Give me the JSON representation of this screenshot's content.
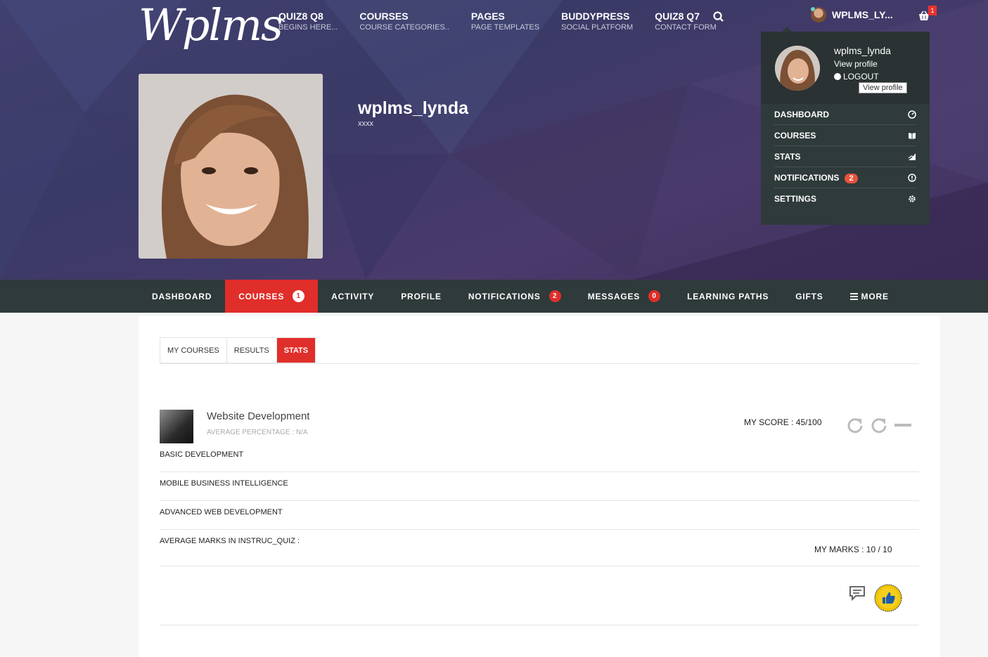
{
  "brand": {
    "logo_text": "Wplms"
  },
  "top_nav": [
    {
      "title": "QUIZ8 Q8",
      "sub": "BEGINS HERE..."
    },
    {
      "title": "COURSES",
      "sub": "COURSE CATEGORIES.."
    },
    {
      "title": "PAGES",
      "sub": "PAGE TEMPLATES"
    },
    {
      "title": "BUDDYPRESS",
      "sub": "SOCIAL PLATFORM"
    },
    {
      "title": "QUIZ8 Q7",
      "sub": "CONTACT FORM"
    }
  ],
  "header_user": {
    "name": "WPLMS_LY...",
    "cart_count": "1"
  },
  "profile": {
    "name": "wplms_lynda",
    "sub": "xxxx"
  },
  "dropdown": {
    "name": "wplms_lynda",
    "view_profile": "View profile",
    "logout": "LOGOUT",
    "tooltip": "View profile",
    "items": [
      {
        "label": "DASHBOARD",
        "icon": "dashboard-icon"
      },
      {
        "label": "COURSES",
        "icon": "book-icon"
      },
      {
        "label": "STATS",
        "icon": "stats-icon"
      },
      {
        "label": "NOTIFICATIONS",
        "badge": "2",
        "icon": "alert-icon"
      },
      {
        "label": "SETTINGS",
        "icon": "gear-icon"
      }
    ]
  },
  "tabs": [
    {
      "label": "DASHBOARD"
    },
    {
      "label": "COURSES",
      "count": "1"
    },
    {
      "label": "ACTIVITY"
    },
    {
      "label": "PROFILE"
    },
    {
      "label": "NOTIFICATIONS",
      "count": "2"
    },
    {
      "label": "MESSAGES",
      "count": "0"
    },
    {
      "label": "LEARNING PATHS"
    },
    {
      "label": "GIFTS"
    },
    {
      "label": "MORE"
    }
  ],
  "subtabs": [
    "MY COURSES",
    "RESULTS",
    "STATS"
  ],
  "course": {
    "title": "Website Development",
    "average": "AVERAGE PERCENTAGE : N/A",
    "score": "MY SCORE : 45/100",
    "units": [
      "BASIC DEVELOPMENT",
      "MOBILE BUSINESS INTELLIGENCE",
      "ADVANCED WEB DEVELOPMENT",
      "AVERAGE MARKS IN INSTRUC_QUIZ :"
    ],
    "my_marks": "MY MARKS : 10 / 10"
  },
  "colors": {
    "accent": "#e02e2a",
    "nav_bg": "#2f3a3b",
    "hero": "#3f3d6b"
  }
}
